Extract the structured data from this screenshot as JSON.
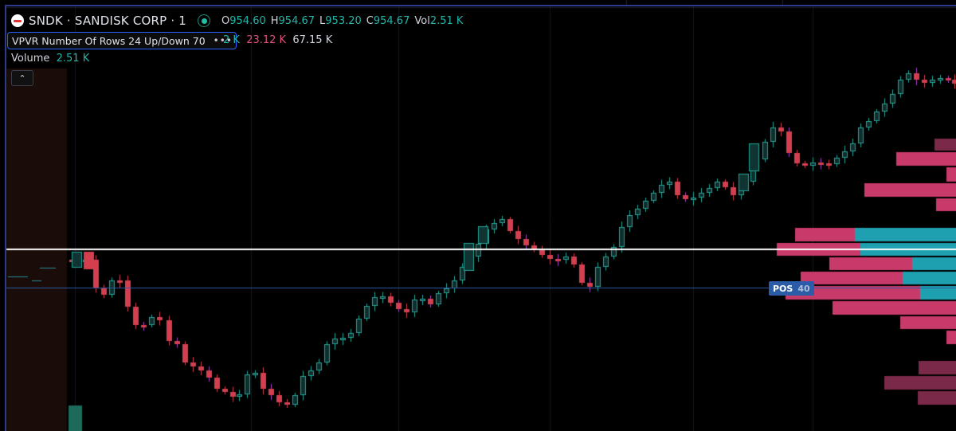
{
  "header": {
    "symbol": "SNDK · SANDISK CORP · 1",
    "ohlc": [
      {
        "label": "O",
        "value": "954.60"
      },
      {
        "label": "H",
        "value": "954.67"
      },
      {
        "label": "L",
        "value": "953.20"
      },
      {
        "label": "C",
        "value": "954.67"
      },
      {
        "label": "Vol",
        "value": "2.51 K"
      }
    ]
  },
  "indicator": {
    "name": "VPVR Number Of Rows 24 Up/Down 70",
    "more_icon": "more-dots-icon",
    "val1": "2 K",
    "val2": "23.12 K",
    "val3": "67.15 K"
  },
  "volume": {
    "label": "Volume",
    "value": "2.51 K"
  },
  "collapse_icon": "chevron-up-icon",
  "position": {
    "label": "POS",
    "qty": "40"
  },
  "colors": {
    "up": "#22a69a",
    "down": "#d33f4f",
    "wick_down": "#b040d0",
    "profile_up": "#1fa0b0",
    "profile_down": "#c83a6a",
    "price_line": "#ffffff",
    "position_line": "#2c5ca8",
    "accent": "#2962ff"
  }
}
